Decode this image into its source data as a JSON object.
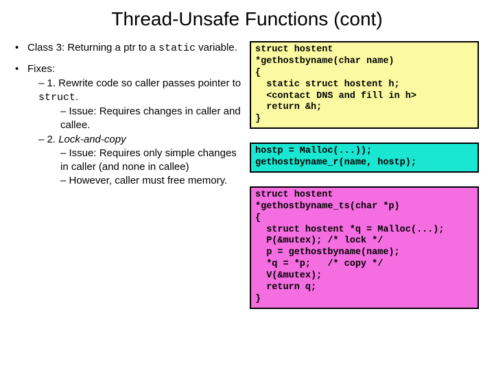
{
  "title": "Thread-Unsafe Functions (cont)",
  "left": {
    "class_pre": "Class 3: Returning a ptr to a",
    "static_word": "static",
    "class_post": " variable.",
    "fixes_label": "Fixes:",
    "fix1_pre": "– 1. Rewrite code so caller passes pointer to ",
    "struct_word": "struct",
    "fix1_post": ".",
    "fix1_issue": "– Issue: Requires changes in caller and callee.",
    "fix2_pre": "– 2. ",
    "fix2_em": "Lock-and-copy",
    "fix2_issue": "– Issue: Requires only simple changes in caller (and none in callee)",
    "fix2_however": "– However, caller must free memory."
  },
  "code": {
    "box1": "struct hostent\n*gethostbyname(char name)\n{\n  static struct hostent h;\n  <contact DNS and fill in h>\n  return &h;\n}",
    "box2": "hostp = Malloc(...));\ngethostbyname_r(name, hostp);",
    "box3": "struct hostent\n*gethostbyname_ts(char *p)\n{\n  struct hostent *q = Malloc(...);\n  P(&mutex); /* lock */\n  p = gethostbyname(name);\n  *q = *p;   /* copy */\n  V(&mutex);\n  return q;\n}"
  }
}
